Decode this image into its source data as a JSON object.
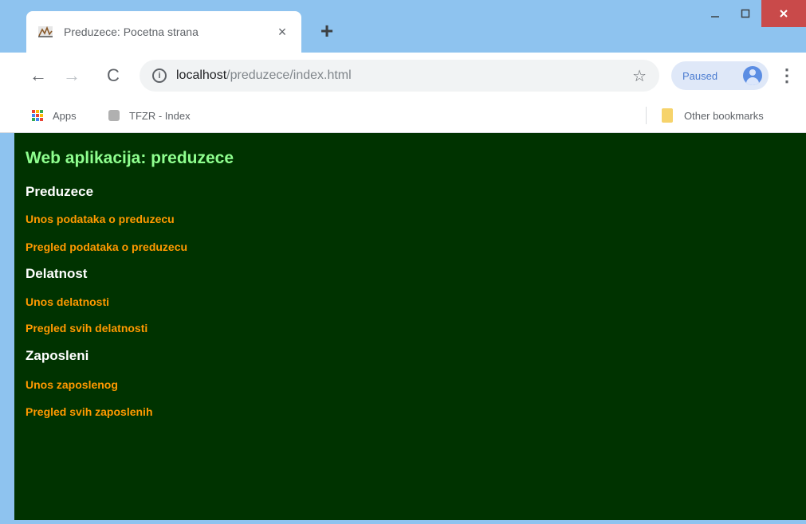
{
  "tab": {
    "title": "Preduzece: Pocetna strana",
    "close": "×"
  },
  "new_tab": "+",
  "window_controls": {
    "minimize": "—",
    "maximize": "☐",
    "close": "✕"
  },
  "toolbar": {
    "back": "←",
    "forward": "→",
    "reload": "C",
    "url_host": "localhost",
    "url_path": "/preduzece/index.html",
    "star": "☆",
    "profile_label": "Paused",
    "menu": "⋮"
  },
  "bookmarks": {
    "apps": "Apps",
    "tfzr": "TFZR - Index",
    "other": "Other bookmarks"
  },
  "page": {
    "title": "Web aplikacija: preduzece",
    "sections": [
      {
        "heading": "Preduzece",
        "links": [
          "Unos podataka o preduzecu",
          "Pregled podataka o preduzecu"
        ]
      },
      {
        "heading": "Delatnost",
        "links": [
          "Unos delatnosti",
          "Pregled svih delatnosti"
        ]
      },
      {
        "heading": "Zaposleni",
        "links": [
          "Unos zaposlenog",
          "Pregled svih zaposlenih"
        ]
      }
    ]
  },
  "colors": {
    "chrome_frame": "#8ec3ef",
    "page_background": "#003300",
    "title_color": "#8fff8f",
    "heading_color": "#ffffff",
    "link_color": "#ff9900"
  }
}
